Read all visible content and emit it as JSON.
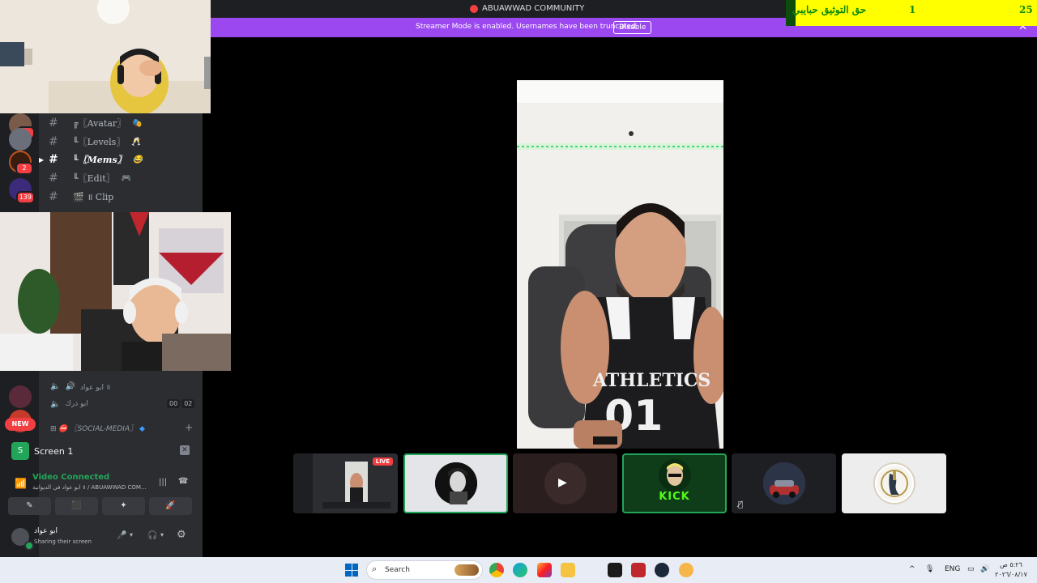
{
  "window": {
    "title": "ABUAWWAD COMMUNITY",
    "streamer_mode_text": "Streamer Mode is enabled. Usernames have been truncated.",
    "disable_label": "Disable"
  },
  "ticker": {
    "text": "حق التوثيق حبايبي",
    "count": "1",
    "total": "25"
  },
  "sidebar": {
    "servers": [
      {
        "badge": "1"
      },
      {
        "badge": ""
      },
      {
        "badge": "2"
      },
      {
        "badge": "139"
      }
    ],
    "new_label": "NEW",
    "channels": [
      {
        "prefix": "╔",
        "name": "〖Avatar〗",
        "emoji": "🎭",
        "active": false
      },
      {
        "prefix": "╙",
        "name": "〖Levels〗",
        "emoji": "🥂",
        "active": false
      },
      {
        "prefix": "╙",
        "name": "〖Mems〗",
        "emoji": "😂",
        "active": true
      },
      {
        "prefix": "╙",
        "name": "〖Edit〗",
        "emoji": "🎮",
        "active": false
      },
      {
        "prefix": "🎬",
        "name": "॥ Clip",
        "emoji": "",
        "active": false
      }
    ],
    "voice_users": [
      "ابو عواد ॥",
      "ابو ذرك"
    ],
    "timer": [
      "00",
      "02"
    ],
    "social_channel": "〖SOCIAL-MEDIA〗"
  },
  "screen_share": {
    "badge": "S",
    "label": "Screen 1"
  },
  "rtc": {
    "status": "Video Connected",
    "subtitle": "ابو عواد في الديوانية ॥ / ABUAWWAD COM...",
    "buttons": [
      "✎",
      "⬛",
      "✦",
      "🚀"
    ]
  },
  "user": {
    "name": "ابو عواد",
    "status": "Sharing their screen"
  },
  "tiles": [
    {
      "kind": "stream",
      "live_label": "LIVE"
    },
    {
      "kind": "avatar"
    },
    {
      "kind": "camera-off"
    },
    {
      "kind": "kick",
      "label": "KICK"
    },
    {
      "kind": "car",
      "muted": true
    },
    {
      "kind": "logo"
    }
  ],
  "taskbar": {
    "search_label": "Search",
    "language": "ENG",
    "time": "٥:٢٦ ص",
    "date": "٢٠٢٦/٠٨/١٧"
  },
  "colors": {
    "streamer_bar": "#9b48f0",
    "ticker_bg": "#ffff00",
    "ticker_text": "#0a8a0a",
    "connected_green": "#23a559",
    "kick_green": "#53fc18"
  }
}
